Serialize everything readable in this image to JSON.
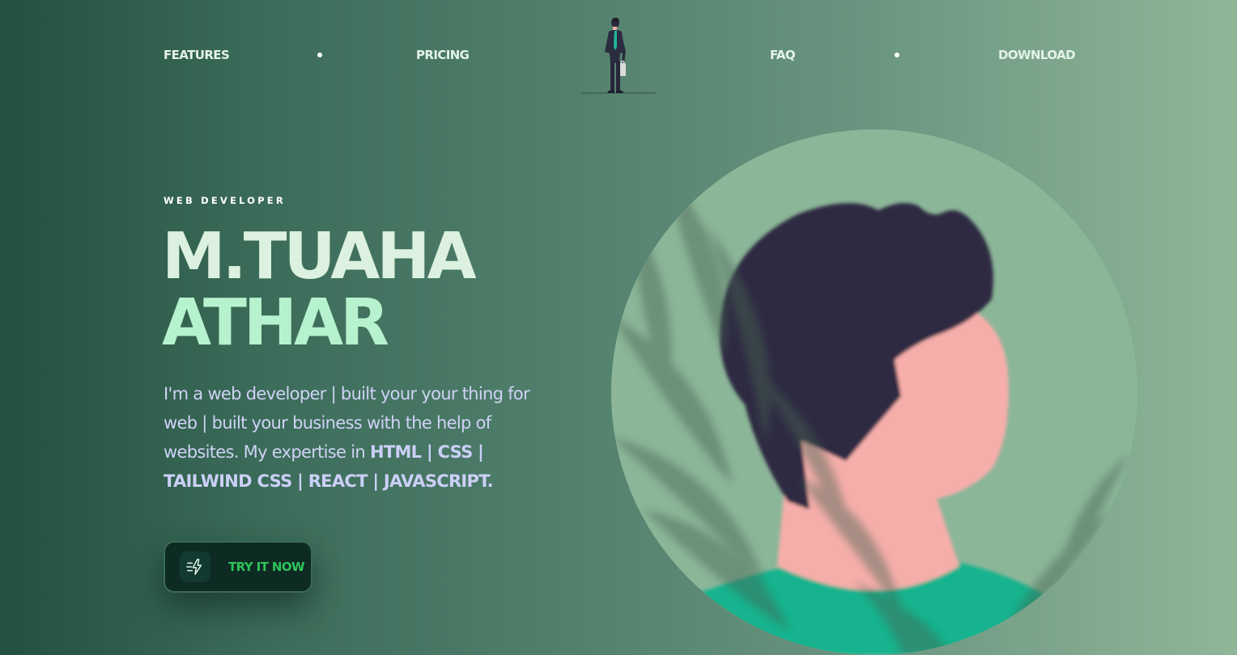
{
  "nav": {
    "links": [
      "FEATURES",
      "PRICING",
      "FAQ",
      "DOWNLOAD"
    ]
  },
  "hero": {
    "eyebrow": "WEB DEVELOPER",
    "title_line1": "M.TUAHA",
    "title_line2": "ATHAR",
    "description": "I'm a web developer | built your your thing for web | built your business with the help of websites. My expertise in ",
    "skills": "HTML | CSS | TAILWIND CSS | REACT | JAVASCRIPT.",
    "cta_label": "TRY IT NOW"
  },
  "icons": {
    "logo": "standing-person-illustration",
    "cta": "lightning-bolt-icon",
    "avatar": "person-avatar-illustration"
  },
  "colors": {
    "title_primary": "#dcf1df",
    "title_accent": "#b6f2cd",
    "cta_text": "#2fc35a",
    "cta_bg": "#0d2b23"
  }
}
